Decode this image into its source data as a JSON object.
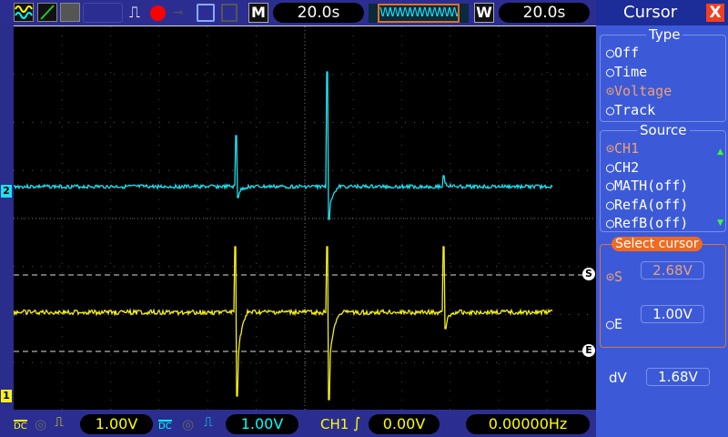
{
  "toolbar": {
    "icons": [
      "waveform-icon",
      "xy-icon",
      "persist-icon",
      "run-icon",
      "record-icon",
      "key-icon",
      "save-icon",
      "print-icon"
    ],
    "main_time_label": "M",
    "main_time": "20.0s",
    "window_label": "W",
    "window_time": "20.0s"
  },
  "bottom": {
    "ch1_coupling": "DC",
    "ch1_scale": "1.00V",
    "ch2_coupling": "DC",
    "ch2_scale": "1.00V",
    "trigger_source": "CH1",
    "trigger_level": "0.00V",
    "frequency": "0.00000Hz"
  },
  "markers": {
    "ch1": "1",
    "ch2": "2",
    "cursor_s": "S",
    "cursor_e": "E"
  },
  "panel": {
    "title": "Cursor",
    "close": "X",
    "type_title": "Type",
    "type_options": [
      "Off",
      "Time",
      "Voltage",
      "Track"
    ],
    "type_selected": "Voltage",
    "source_title": "Source",
    "source_options": [
      "CH1",
      "CH2",
      "MATH(off)",
      "RefA(off)",
      "RefB(off)"
    ],
    "source_selected": "CH1",
    "select_title": "Select cursor",
    "s_label": "S",
    "s_value": "2.68V",
    "e_label": "E",
    "e_value": "1.00V",
    "dv_label": "dV",
    "dv_value": "1.68V"
  },
  "colors": {
    "ch1": "#f5f01a",
    "ch2": "#1ee0f0",
    "accent": "#f07030"
  }
}
